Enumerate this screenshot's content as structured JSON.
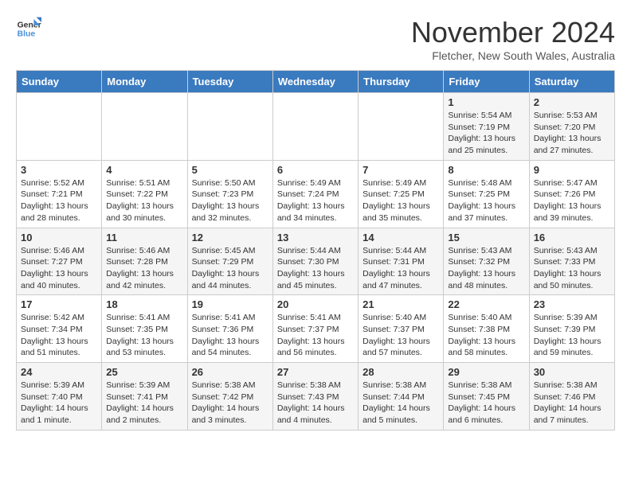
{
  "logo": {
    "line1": "General",
    "line2": "Blue"
  },
  "title": "November 2024",
  "location": "Fletcher, New South Wales, Australia",
  "weekdays": [
    "Sunday",
    "Monday",
    "Tuesday",
    "Wednesday",
    "Thursday",
    "Friday",
    "Saturday"
  ],
  "weeks": [
    [
      {
        "day": "",
        "info": ""
      },
      {
        "day": "",
        "info": ""
      },
      {
        "day": "",
        "info": ""
      },
      {
        "day": "",
        "info": ""
      },
      {
        "day": "",
        "info": ""
      },
      {
        "day": "1",
        "info": "Sunrise: 5:54 AM\nSunset: 7:19 PM\nDaylight: 13 hours\nand 25 minutes."
      },
      {
        "day": "2",
        "info": "Sunrise: 5:53 AM\nSunset: 7:20 PM\nDaylight: 13 hours\nand 27 minutes."
      }
    ],
    [
      {
        "day": "3",
        "info": "Sunrise: 5:52 AM\nSunset: 7:21 PM\nDaylight: 13 hours\nand 28 minutes."
      },
      {
        "day": "4",
        "info": "Sunrise: 5:51 AM\nSunset: 7:22 PM\nDaylight: 13 hours\nand 30 minutes."
      },
      {
        "day": "5",
        "info": "Sunrise: 5:50 AM\nSunset: 7:23 PM\nDaylight: 13 hours\nand 32 minutes."
      },
      {
        "day": "6",
        "info": "Sunrise: 5:49 AM\nSunset: 7:24 PM\nDaylight: 13 hours\nand 34 minutes."
      },
      {
        "day": "7",
        "info": "Sunrise: 5:49 AM\nSunset: 7:25 PM\nDaylight: 13 hours\nand 35 minutes."
      },
      {
        "day": "8",
        "info": "Sunrise: 5:48 AM\nSunset: 7:25 PM\nDaylight: 13 hours\nand 37 minutes."
      },
      {
        "day": "9",
        "info": "Sunrise: 5:47 AM\nSunset: 7:26 PM\nDaylight: 13 hours\nand 39 minutes."
      }
    ],
    [
      {
        "day": "10",
        "info": "Sunrise: 5:46 AM\nSunset: 7:27 PM\nDaylight: 13 hours\nand 40 minutes."
      },
      {
        "day": "11",
        "info": "Sunrise: 5:46 AM\nSunset: 7:28 PM\nDaylight: 13 hours\nand 42 minutes."
      },
      {
        "day": "12",
        "info": "Sunrise: 5:45 AM\nSunset: 7:29 PM\nDaylight: 13 hours\nand 44 minutes."
      },
      {
        "day": "13",
        "info": "Sunrise: 5:44 AM\nSunset: 7:30 PM\nDaylight: 13 hours\nand 45 minutes."
      },
      {
        "day": "14",
        "info": "Sunrise: 5:44 AM\nSunset: 7:31 PM\nDaylight: 13 hours\nand 47 minutes."
      },
      {
        "day": "15",
        "info": "Sunrise: 5:43 AM\nSunset: 7:32 PM\nDaylight: 13 hours\nand 48 minutes."
      },
      {
        "day": "16",
        "info": "Sunrise: 5:43 AM\nSunset: 7:33 PM\nDaylight: 13 hours\nand 50 minutes."
      }
    ],
    [
      {
        "day": "17",
        "info": "Sunrise: 5:42 AM\nSunset: 7:34 PM\nDaylight: 13 hours\nand 51 minutes."
      },
      {
        "day": "18",
        "info": "Sunrise: 5:41 AM\nSunset: 7:35 PM\nDaylight: 13 hours\nand 53 minutes."
      },
      {
        "day": "19",
        "info": "Sunrise: 5:41 AM\nSunset: 7:36 PM\nDaylight: 13 hours\nand 54 minutes."
      },
      {
        "day": "20",
        "info": "Sunrise: 5:41 AM\nSunset: 7:37 PM\nDaylight: 13 hours\nand 56 minutes."
      },
      {
        "day": "21",
        "info": "Sunrise: 5:40 AM\nSunset: 7:37 PM\nDaylight: 13 hours\nand 57 minutes."
      },
      {
        "day": "22",
        "info": "Sunrise: 5:40 AM\nSunset: 7:38 PM\nDaylight: 13 hours\nand 58 minutes."
      },
      {
        "day": "23",
        "info": "Sunrise: 5:39 AM\nSunset: 7:39 PM\nDaylight: 13 hours\nand 59 minutes."
      }
    ],
    [
      {
        "day": "24",
        "info": "Sunrise: 5:39 AM\nSunset: 7:40 PM\nDaylight: 14 hours\nand 1 minute."
      },
      {
        "day": "25",
        "info": "Sunrise: 5:39 AM\nSunset: 7:41 PM\nDaylight: 14 hours\nand 2 minutes."
      },
      {
        "day": "26",
        "info": "Sunrise: 5:38 AM\nSunset: 7:42 PM\nDaylight: 14 hours\nand 3 minutes."
      },
      {
        "day": "27",
        "info": "Sunrise: 5:38 AM\nSunset: 7:43 PM\nDaylight: 14 hours\nand 4 minutes."
      },
      {
        "day": "28",
        "info": "Sunrise: 5:38 AM\nSunset: 7:44 PM\nDaylight: 14 hours\nand 5 minutes."
      },
      {
        "day": "29",
        "info": "Sunrise: 5:38 AM\nSunset: 7:45 PM\nDaylight: 14 hours\nand 6 minutes."
      },
      {
        "day": "30",
        "info": "Sunrise: 5:38 AM\nSunset: 7:46 PM\nDaylight: 14 hours\nand 7 minutes."
      }
    ]
  ]
}
